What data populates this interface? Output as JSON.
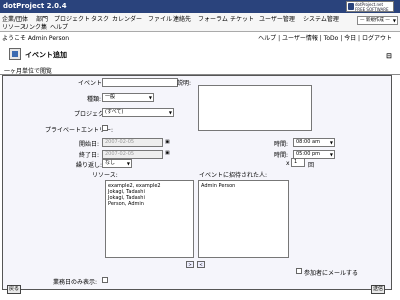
{
  "app": {
    "title": "dotProject 2.0.4",
    "logo_text": "dotProject.net FREE SOFTWARE"
  },
  "menu": {
    "items": [
      "企業/団体",
      "部門",
      "プロジェクト",
      "タスク",
      "カレンダー",
      "ファイル",
      "連絡先",
      "フォーラム",
      "チケット",
      "ユーザー管理",
      "システム管理",
      "リソース",
      "リンク集",
      "ヘルプ"
    ],
    "module_select": "— 新規作成 —"
  },
  "header": {
    "welcome": "ようこそ Admin Person",
    "links": "ヘルプ | ユーザー情報 | ToDo | 今日 | ログアウト"
  },
  "page": {
    "title": "イベント追加",
    "collapse": "⊟",
    "week_link": "一ヶ月単位で閲覧"
  },
  "form": {
    "event_name_label": "イベント名:",
    "event_name_value": "",
    "type_label": "種類:",
    "type_value": "一般",
    "project_label": "プロジェクト:",
    "project_value": "(すべて)",
    "private_label": "プライベートエントリー:",
    "start_date_label": "開始日:",
    "start_date_value": "2007-02-05",
    "end_date_label": "終了日:",
    "end_date_value": "2007-02-05",
    "start_time_label": "時間:",
    "start_time_value": "08:00 am",
    "end_time_label": "時間:",
    "end_time_value": "05:00 pm",
    "recurs_label": "繰り返し:",
    "recurs_value": "なし",
    "recurs_count_prefix": "x",
    "recurs_count_value": "1",
    "recurs_count_suffix": "回",
    "description_label": "説明:",
    "resources_label": "リソース:",
    "invited_label": "イベントに招待された人:",
    "resources": [
      "example2, example2",
      "Jokagi, Tadashi",
      "Jokagi, Tadashi",
      "Person, Admin"
    ],
    "invited": [
      "Admin Person"
    ],
    "add_button": ">",
    "remove_button": "<",
    "notify_label": "参加者にメールする",
    "working_days_label": "業務日のみ表示:",
    "back_button": "戻る",
    "submit_button": "送信"
  }
}
